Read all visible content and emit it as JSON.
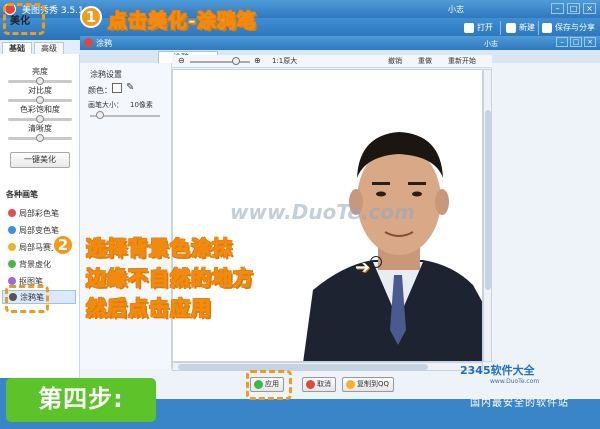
{
  "app": {
    "title": "美图秀秀 3.5.1",
    "user": "小志",
    "window_buttons": [
      "–",
      "□",
      "×"
    ],
    "toolbar": {
      "open": "打开",
      "new": "新建",
      "save_share": "保存与分享"
    },
    "main_tab": "美化",
    "left_tabs": [
      "基础",
      "高级"
    ]
  },
  "adjust": {
    "sliders": [
      {
        "label": "亮度",
        "value": 0.5
      },
      {
        "label": "对比度",
        "value": 0.5
      },
      {
        "label": "色彩饱和度",
        "value": 0.5
      },
      {
        "label": "清晰度",
        "value": 0.5
      }
    ],
    "one_click": "一键美化"
  },
  "brushes": {
    "header": "各种画笔",
    "items": [
      {
        "label": "局部彩色笔",
        "color": "#e94b4b"
      },
      {
        "label": "局部变色笔",
        "color": "#3d8fe0"
      },
      {
        "label": "局部马赛克",
        "color": "#f0b42a"
      },
      {
        "label": "背景虚化",
        "color": "#47b84a"
      },
      {
        "label": "抠图笔",
        "color": "#9a6bd8"
      },
      {
        "label": "涂鸦笔",
        "color": "#555555"
      }
    ]
  },
  "dialog": {
    "title": "涂鸦",
    "tab": "涂鸦",
    "user": "小志",
    "window_buttons": [
      "–",
      "□",
      "×"
    ],
    "settings_title": "涂鸦设置",
    "color_label": "颜色：",
    "brush_size_label": "画笔大小：",
    "brush_size_value": "10像素",
    "zoom_actual": "1:1原大",
    "undo": "撤销",
    "redo": "重做",
    "restart": "重新开始",
    "apply": "应用",
    "cancel": "取消",
    "copy_qq": "复制到QQ"
  },
  "canvas": {
    "watermark": "www.DuoTe.com"
  },
  "annotations": {
    "step1_num": "1",
    "step1_text": "点击美化-涂鸦笔",
    "step2_num": "2",
    "step2_line1": "选择背景色涂抹",
    "step2_line2": "边缘不自然的地方",
    "step2_line3": "然后点击应用",
    "step4": "第四步:"
  },
  "branding": {
    "logo": "2345软件大全",
    "site": "www.DuoTe.com",
    "tagline": "国内最安全的软件站"
  },
  "colors": {
    "accent_orange": "#f39a1e",
    "step_green": "#5cc32a",
    "title_blue": "#2f78bd"
  }
}
